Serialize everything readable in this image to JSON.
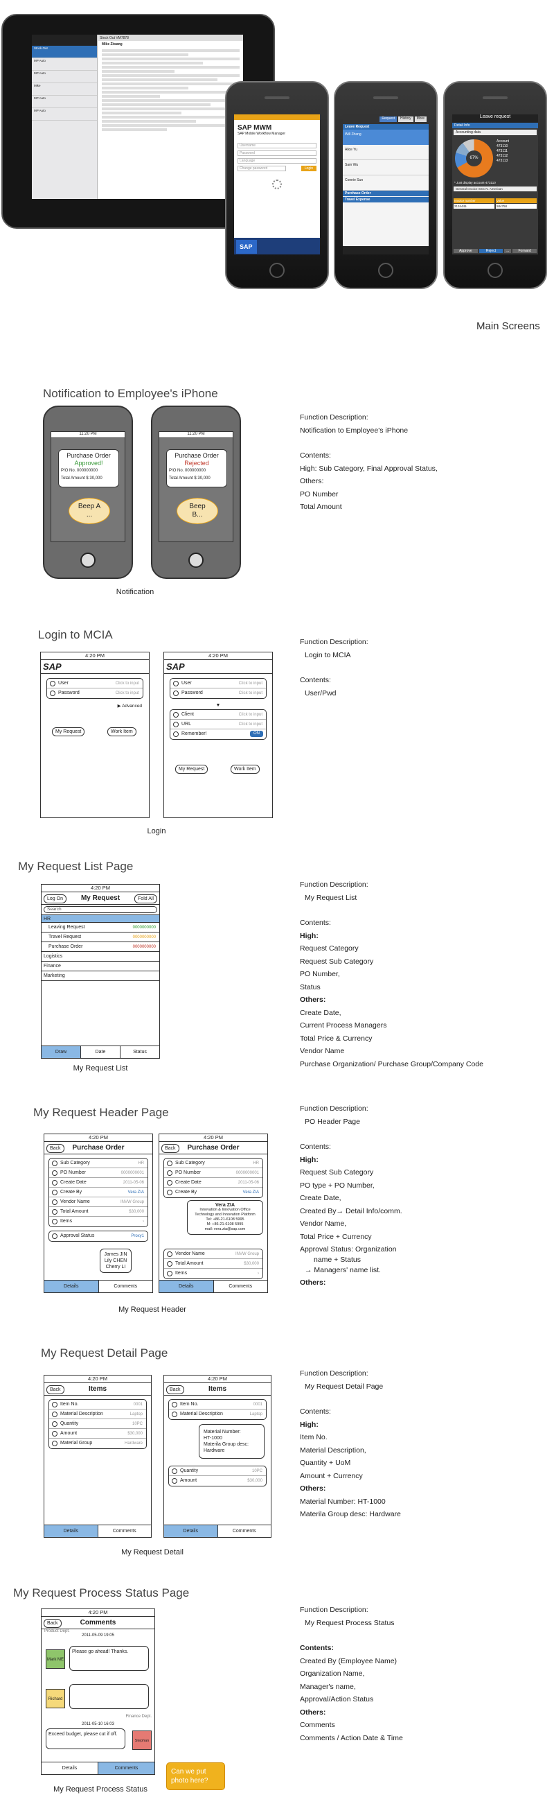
{
  "main_screens": {
    "caption": "Main Screens",
    "ipad_list_titles": [
      "Stock Out",
      "MP Auto",
      "MP Auto",
      "Mike",
      "MP Auto",
      "MP Auto"
    ],
    "ipad_header": "Stock Out VM7878",
    "ipad_person": "Mike Ziwang",
    "login_title": "SAP MWM",
    "login_subtitle": "SAP Mobile Workflow Manager",
    "login_fields": [
      "Username",
      "Password",
      "Language",
      "Change password"
    ],
    "login_button": "Login",
    "list_tabs": [
      "Request",
      "History",
      "More"
    ],
    "list_sections": [
      "Leave Request",
      "Purchase Order",
      "Travel Expense"
    ],
    "list_items": [
      "Will Zhang",
      "Alice Yu",
      "Sam Wu",
      "Connie Sun"
    ],
    "detail_title": "Leave request",
    "detail_section": "Detail Info",
    "detail_sub": "Accounting data",
    "detail_account_label": "Account",
    "detail_accounts": [
      "473110",
      "473111",
      "473112",
      "473113"
    ],
    "detail_pct": "67%",
    "detail_note": "* Just display account-473110",
    "detail_vendor": "General Invoice SSC N. American",
    "detail_cols": [
      "Invoice number",
      "Value"
    ],
    "detail_vals": [
      "2134445",
      "584758"
    ],
    "detail_buttons": [
      "Approve",
      "Reject",
      "...",
      "Forward"
    ]
  },
  "notification": {
    "heading": "Notification to Employee's iPhone",
    "caption": "Notification",
    "status_time": "11:20 PM",
    "phone1": {
      "title": "Purchase Order",
      "status": "Approved!",
      "po_label": "P/O No.",
      "po_value": "000000000",
      "total_label": "Total Amount",
      "total_value": "$ 30,000",
      "beep": "Beep A",
      "beep2": "..."
    },
    "phone2": {
      "title": "Purchase Order",
      "status": "Rejected",
      "po_label": "P/O No.",
      "po_value": "000000000",
      "total_label": "Total Amount",
      "total_value": "$ 30,000",
      "beep": "Beep",
      "beep2": "B..."
    },
    "desc": [
      "Function Description:",
      "Notification to Employee's iPhone",
      "",
      "Contents:",
      "High: Sub Category, Final Approval Status,",
      "Others:",
      "PO Number",
      "Total Amount"
    ]
  },
  "login": {
    "heading": "Login to MCIA",
    "caption": "Login",
    "time": "4:20 PM",
    "logo": "SAP",
    "fields": [
      {
        "label": "User",
        "hint": "Click to input"
      },
      {
        "label": "Password",
        "hint": "Click to input"
      }
    ],
    "fields2": [
      {
        "label": "User",
        "hint": "Click to input"
      },
      {
        "label": "Password",
        "hint": "Click to input"
      },
      {
        "label": "Client",
        "hint": "Click to input"
      },
      {
        "label": "URL",
        "hint": "Click to input"
      },
      {
        "label": "Remember!",
        "hint": ""
      }
    ],
    "advanced": "Advanced",
    "on": "ON",
    "buttons": [
      "My Request",
      "Work Item"
    ],
    "desc": [
      "Function Description:",
      "Login to MCIA",
      "",
      "Contents:",
      "User/Pwd"
    ]
  },
  "request_list": {
    "heading": "My Request List Page",
    "caption": "My Request List",
    "time": "4:20 PM",
    "title": "My Request",
    "left_btn": "Log On",
    "right_btn": "Fold All",
    "search": "Search",
    "groups": [
      "HR",
      "Logistics",
      "Finance",
      "Marketing"
    ],
    "items": [
      {
        "label": "Leaving Request",
        "num": "0000000000"
      },
      {
        "label": "Travel Request",
        "num": "0000000000"
      },
      {
        "label": "Purchase Order",
        "num": "0000000000"
      }
    ],
    "tabs": [
      "Draw",
      "Date",
      "Status"
    ],
    "desc": [
      "Function Description:",
      "My Request List",
      "",
      "Contents:",
      "High:",
      "Request Category",
      "Request Sub Category",
      "PO Number,",
      "Status",
      "Others:",
      "Create Date,",
      "Current Process Managers",
      "Total Price & Currency",
      "Vendor Name",
      "Purchase Organization/ Purchase Group/Company Code"
    ]
  },
  "header_page": {
    "heading": "My Request Header Page",
    "caption": "My Request Header",
    "time": "4:20 PM",
    "title": "Purchase Order",
    "back": "Back",
    "rows": [
      {
        "label": "Sub Category",
        "val": "HR"
      },
      {
        "label": "PO Number",
        "val": "0000000001"
      },
      {
        "label": "Create Date",
        "val": "2011-05-06"
      },
      {
        "label": "Create By",
        "val": "Vera ZIA"
      },
      {
        "label": "Vendor Name",
        "val": "INVW Group"
      },
      {
        "label": "Total Amount",
        "val": "$30,000"
      },
      {
        "label": "Items",
        "val": ""
      }
    ],
    "approval": {
      "label": "Approval Status",
      "val": "Proxy1"
    },
    "managers": [
      "James JIN",
      "Lily CHEN",
      "Cherry LI"
    ],
    "popup": [
      "Vera ZIA",
      "Innovation & Innovation Office",
      "Technology and Innovation Platform",
      "Tel: +86-21-6108 5995",
      "M: +86-21-6108 5995",
      "mail: vera.zia@sap.com"
    ],
    "tabs": [
      "Details",
      "Comments"
    ],
    "desc": [
      "Function Description:",
      "PO Header Page",
      "",
      "Contents:",
      "High:",
      "Request Sub Category",
      "PO type + PO Number,",
      "Create Date,",
      "Created By→ Detail Info/comm.",
      "Vendor Name,",
      "Total Price + Currency",
      "Approval Status:  Organization",
      "name + Status",
      "→ Managers' name list.",
      "Others:"
    ]
  },
  "detail_page": {
    "heading": "My Request Detail Page",
    "caption": "My Request Detail",
    "time": "4:20 PM",
    "title": "Items",
    "back": "Back",
    "rows": [
      {
        "label": "Item No.",
        "val": "0001"
      },
      {
        "label": "Material Description",
        "val": "Laptop"
      },
      {
        "label": "Quantity",
        "val": "10PC"
      },
      {
        "label": "Amount",
        "val": "$30,000"
      },
      {
        "label": "Material Group",
        "val": "Hardware"
      }
    ],
    "rows2": [
      {
        "label": "Item No.",
        "val": "0001"
      },
      {
        "label": "Material Description",
        "val": "Laptop"
      },
      {
        "label": "Quantity",
        "val": "10PC"
      },
      {
        "label": "Amount",
        "val": "$30,000"
      }
    ],
    "popup": [
      "Material Number:",
      "HT-1000",
      "Materila Group desc:",
      "Hardware"
    ],
    "tabs": [
      "Details",
      "Comments"
    ],
    "desc": [
      "Function Description:",
      "My Request Detail Page",
      "",
      "Contents:",
      "High:",
      "Item No.",
      "Material Description,",
      "Quantity + UoM",
      "Amount + Currency",
      "Others:",
      "Material Number: HT-1000",
      "Materila Group desc: Hardware"
    ]
  },
  "process_page": {
    "heading": "My Request Process Status Page",
    "caption": "My Request Process Status",
    "time": "4:20 PM",
    "title": "Comments",
    "back": "Back",
    "org1": "Product Dept.",
    "date1": "2011-05-09 19:05",
    "msg1": "Please go ahead! Thanks.",
    "person1": "Mark ME",
    "person2": "Richard",
    "org2": "Finance Dept.",
    "date2": "2011-05-10 16:03",
    "msg3": "Exceed budget, please cut if off.",
    "person3": "Stephan",
    "tabs": [
      "Details",
      "Comments"
    ],
    "note": "Can we put photo here?",
    "desc": [
      "Function Description:",
      "My Request Process Status",
      "",
      "Contents:",
      "Created By (Employee Name)",
      "Organization Name,",
      "Manager's name,",
      "Approval/Action Status",
      "Others:",
      "Comments",
      "Comments / Action Date & Time"
    ]
  }
}
